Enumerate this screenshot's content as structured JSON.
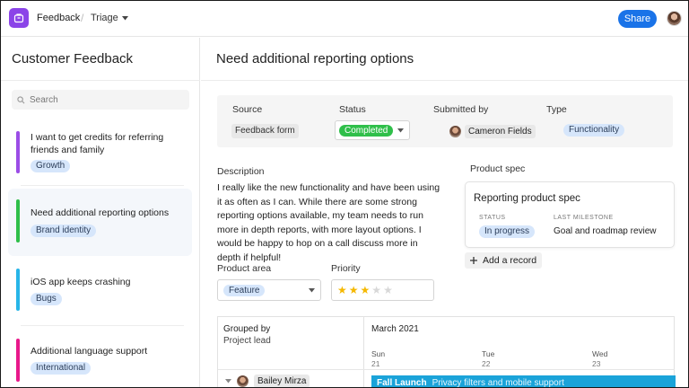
{
  "topbar": {
    "app_name": "Feedback",
    "breadcrumb_separator": "/",
    "view_name": "Triage",
    "share_label": "Share"
  },
  "sidebar": {
    "title": "Customer Feedback",
    "search_placeholder": "Search",
    "items": [
      {
        "title": "I want to get credits for referring friends and family",
        "tag": "Growth",
        "accent": "#9b4de6",
        "active": false
      },
      {
        "title": "Need additional reporting options",
        "tag": "Brand identity",
        "accent": "#2fbf4a",
        "active": true
      },
      {
        "title": "iOS app keeps crashing",
        "tag": "Bugs",
        "accent": "#27b5e8",
        "active": false
      },
      {
        "title": "Additional language support",
        "tag": "International",
        "accent": "#e8198b",
        "active": false
      }
    ]
  },
  "detail": {
    "title": "Need additional reporting options",
    "fields": {
      "source_label": "Source",
      "source_value": "Feedback form",
      "status_label": "Status",
      "status_value": "Completed",
      "submitted_label": "Submitted by",
      "submitted_value": "Cameron Fields",
      "type_label": "Type",
      "type_value": "Functionality"
    },
    "description_label": "Description",
    "description": "I really like the new functionality and have been using it as often as I can. While there are some strong reporting options available, my team needs to run more in depth reports, with more layout options. I would be happy to hop on a call discuss more in depth if helpful!",
    "product_spec_label": "Product spec",
    "spec": {
      "title": "Reporting product spec",
      "status_label": "STATUS",
      "status_value": "In progress",
      "milestone_label": "LAST MILESTONE",
      "milestone_value": "Goal and roadmap review"
    },
    "add_record_label": "Add a record",
    "product_area_label": "Product area",
    "product_area_value": "Feature",
    "priority_label": "Priority",
    "priority_rating": 3,
    "priority_max": 5
  },
  "timeline": {
    "grouped_by_label": "Grouped by",
    "grouped_by_value": "Project lead",
    "month": "March 2021",
    "days": [
      {
        "name": "Sun",
        "num": "21"
      },
      {
        "name": "Tue",
        "num": "22"
      },
      {
        "name": "Wed",
        "num": "23"
      }
    ],
    "lead_name": "Bailey Mirza",
    "event_title": "Fall Launch",
    "event_subtitle": "Privacy filters and mobile support"
  },
  "colors": {
    "brand": "#8b44e8",
    "share": "#1a73e8",
    "status_completed": "#2fbf4a",
    "star_filled": "#f5b800",
    "star_empty": "#d8d8d8",
    "event": "#1aa3d9"
  }
}
